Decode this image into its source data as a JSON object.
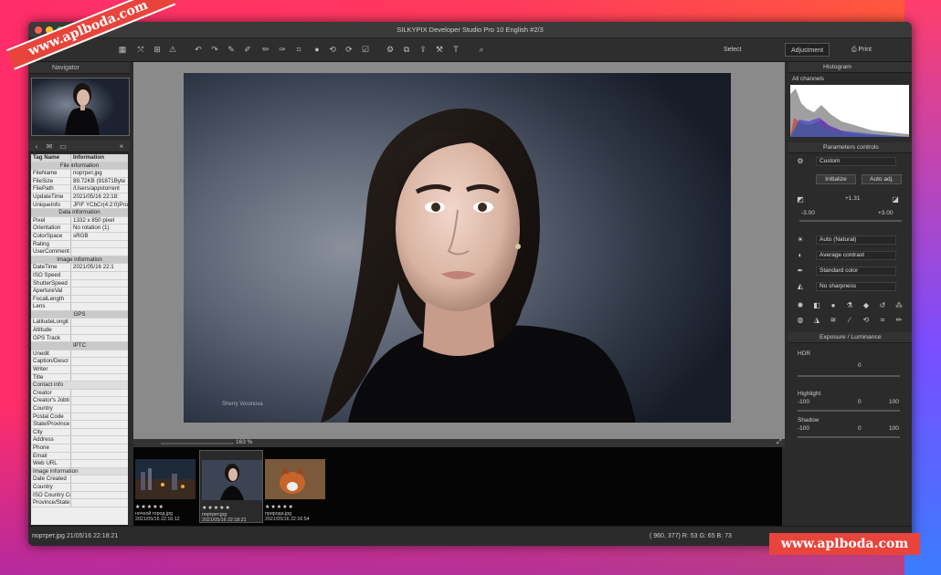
{
  "window": {
    "title": "SILKYPIX Developer Studio Pro 10 English   #2/3"
  },
  "toolbar": {
    "select_label": "Select",
    "adjustment_label": "Adjustment",
    "print_label": "Print"
  },
  "navigator": {
    "title": "Navigator"
  },
  "info_table": {
    "header": {
      "k": "Tag Name",
      "v": "Information"
    },
    "rows": [
      {
        "type": "sec",
        "k": "File information"
      },
      {
        "k": "FileName",
        "v": "портрет.jpg"
      },
      {
        "k": "FileSize",
        "v": "89.72KB (91871Byte"
      },
      {
        "k": "FilePath",
        "v": "/Users/appstorrent"
      },
      {
        "k": "UpdateTime",
        "v": "2021/05/16 22:18:"
      },
      {
        "k": "UniqueInfo",
        "v": "JFIF YCbCr(4:2:0)Pro"
      },
      {
        "type": "sec",
        "k": "Data information"
      },
      {
        "k": "Pixel",
        "v": "1332 x 850 pixel"
      },
      {
        "k": "Orientation",
        "v": "No rotation (1)"
      },
      {
        "k": "ColorSpace",
        "v": "sRGB"
      },
      {
        "k": "Rating",
        "v": ""
      },
      {
        "k": "UserComment",
        "v": ""
      },
      {
        "type": "sec",
        "k": "Image information"
      },
      {
        "k": "DateTime",
        "v": "2021/05/16 22:1"
      },
      {
        "k": "ISO Speed",
        "v": ""
      },
      {
        "k": "ShutterSpeed",
        "v": ""
      },
      {
        "k": "ApertureVal",
        "v": ""
      },
      {
        "k": "FocalLength",
        "v": ""
      },
      {
        "k": "Lens",
        "v": ""
      },
      {
        "type": "sec",
        "k": "GPS"
      },
      {
        "k": "LatitudeLongit",
        "v": ""
      },
      {
        "k": "Altitude",
        "v": ""
      },
      {
        "k": "GPS Track",
        "v": ""
      },
      {
        "type": "sec",
        "k": "IPTC"
      },
      {
        "k": "Unedit",
        "v": ""
      },
      {
        "k": "Caption/Descr",
        "v": ""
      },
      {
        "k": "Writer",
        "v": ""
      },
      {
        "k": "Title",
        "v": ""
      },
      {
        "type": "sub",
        "k": "Contact info"
      },
      {
        "k": "Creator",
        "v": ""
      },
      {
        "k": "Creator's Jobti",
        "v": ""
      },
      {
        "k": "Country",
        "v": ""
      },
      {
        "k": "Postal Code",
        "v": ""
      },
      {
        "k": "State/Province",
        "v": ""
      },
      {
        "k": "City",
        "v": ""
      },
      {
        "k": "Address",
        "v": ""
      },
      {
        "k": "Phone",
        "v": ""
      },
      {
        "k": "Email",
        "v": ""
      },
      {
        "k": "Web URL",
        "v": ""
      },
      {
        "type": "sub",
        "k": "Image information"
      },
      {
        "k": "Date Created",
        "v": ""
      },
      {
        "k": "Country",
        "v": ""
      },
      {
        "k": "ISO Country Co",
        "v": ""
      },
      {
        "k": "Province/State",
        "v": ""
      }
    ]
  },
  "preview": {
    "signature": "Sherry Voronova",
    "zoom": "163 %"
  },
  "filmstrip": {
    "items": [
      {
        "name": "ночной город.jpg",
        "date": "2021/05/16 22:16:12",
        "stars": "★★★★★"
      },
      {
        "name": "портрет.jpg",
        "date": "2021/05/16 22:18:21",
        "stars": "★★★★★"
      },
      {
        "name": "природа.jpg",
        "date": "2021/05/16 22:16:54",
        "stars": "★★★★★"
      }
    ]
  },
  "histogram": {
    "title": "Histogram",
    "channel": "All channels"
  },
  "params": {
    "title": "Parameters controls",
    "preset": "Custom",
    "initialize": "Initialize",
    "auto_adj": "Auto adj.",
    "exposure_val": "+1.31",
    "range_low": "-3.00",
    "range_high": "+3.00",
    "wb": "Auto (Natural)",
    "contrast": "Average contrast",
    "color": "Standard color",
    "sharpness": "No sharpness"
  },
  "exposure": {
    "title": "Exposure / Luminance",
    "hdr_label": "HDR",
    "hdr_val": "0",
    "highlight_label": "Highlight",
    "highlight_min": "-100",
    "highlight_val": "0",
    "highlight_max": "100",
    "shadow_label": "Shadow",
    "shadow_min": "-100",
    "shadow_val": "0",
    "shadow_max": "100"
  },
  "status": {
    "left": "портрет.jpg 21/05/16 22:18:21",
    "coords": "( 960, 377)  R: 53  G: 65  B: 73"
  },
  "watermark": {
    "text": "www.aplboda.com"
  }
}
